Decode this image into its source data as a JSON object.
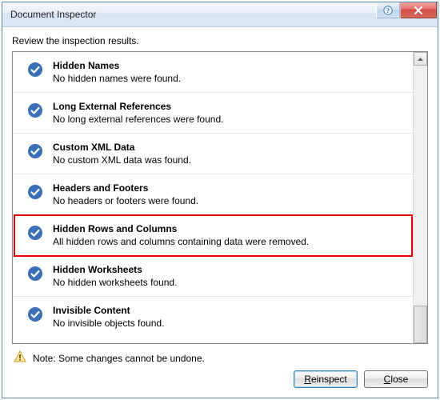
{
  "window": {
    "title": "Document Inspector"
  },
  "instruction": "Review the inspection results.",
  "items": [
    {
      "title": "Hidden Names",
      "desc": "No hidden names were found."
    },
    {
      "title": "Long External References",
      "desc": "No long external references were found."
    },
    {
      "title": "Custom XML Data",
      "desc": "No custom XML data was found."
    },
    {
      "title": "Headers and Footers",
      "desc": "No headers or footers were found."
    },
    {
      "title": "Hidden Rows and Columns",
      "desc": "All hidden rows and columns containing data were removed."
    },
    {
      "title": "Hidden Worksheets",
      "desc": "No hidden worksheets found."
    },
    {
      "title": "Invisible Content",
      "desc": "No invisible objects found."
    }
  ],
  "highlight_index": 4,
  "note": "Note: Some changes cannot be undone.",
  "buttons": {
    "reinspect": "Reinspect",
    "close": "Close"
  }
}
